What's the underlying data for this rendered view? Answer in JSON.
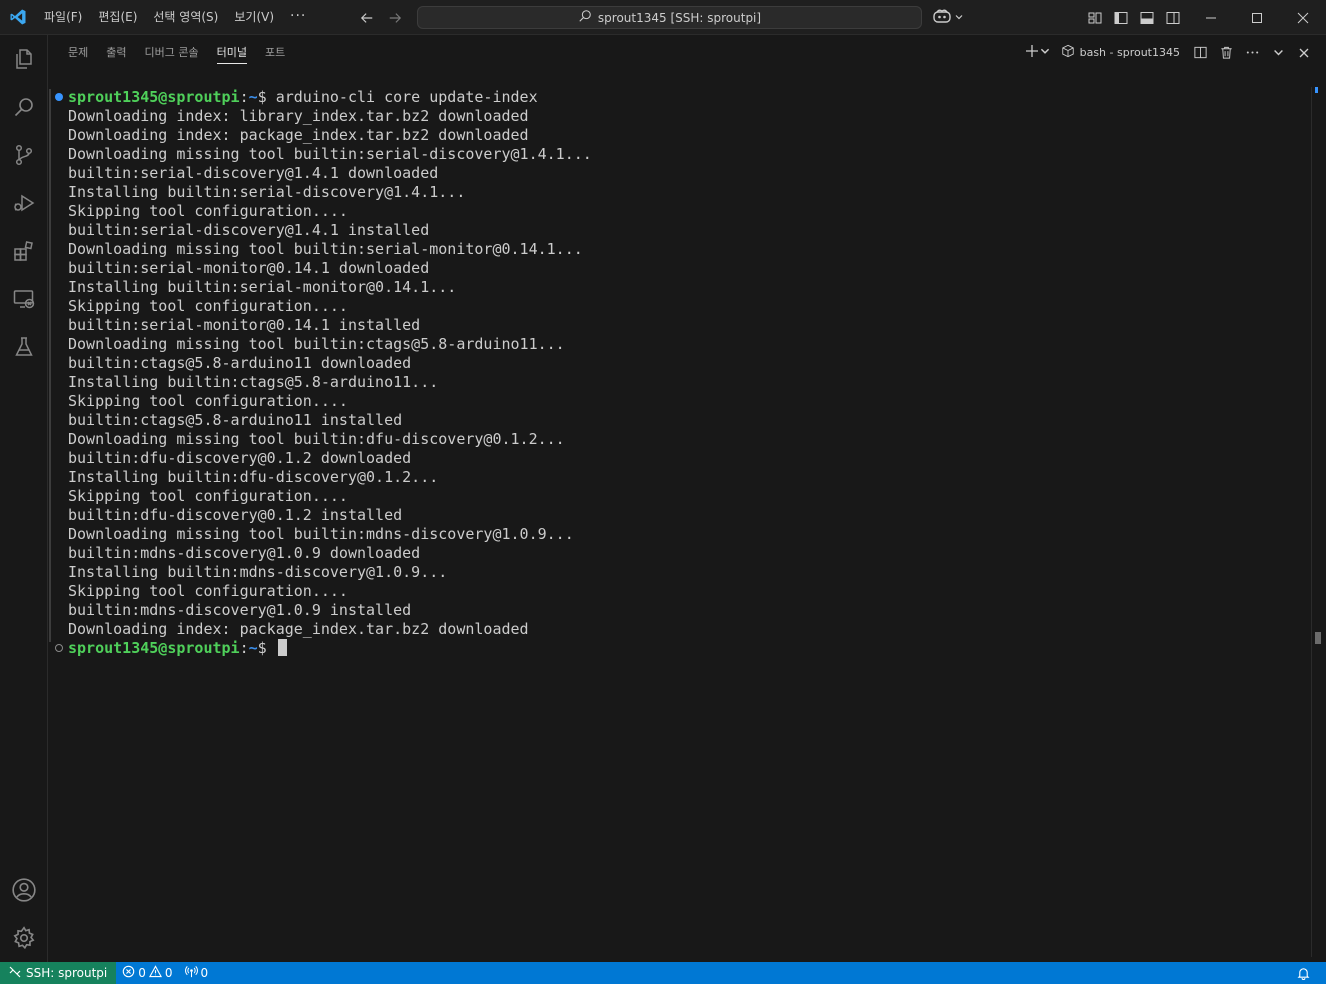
{
  "titlebar": {
    "menu": [
      {
        "label": "파일(F)"
      },
      {
        "label": "편집(E)"
      },
      {
        "label": "선택 영역(S)"
      },
      {
        "label": "보기(V)"
      }
    ],
    "more": "···",
    "command_center": "sprout1345 [SSH: sproutpi]"
  },
  "panel": {
    "tabs": [
      {
        "label": "문제"
      },
      {
        "label": "출력"
      },
      {
        "label": "디버그 콘솔"
      },
      {
        "label": "터미널"
      },
      {
        "label": "포트"
      }
    ],
    "active_tab": "터미널",
    "terminal_name": "bash - sprout1345"
  },
  "terminal": {
    "prompt_user": "sprout1345@sproutpi",
    "prompt_sep": ":",
    "prompt_path": "~",
    "prompt_symbol": "$",
    "command": "arduino-cli core update-index",
    "output": [
      "Downloading index: library_index.tar.bz2 downloaded",
      "Downloading index: package_index.tar.bz2 downloaded",
      "Downloading missing tool builtin:serial-discovery@1.4.1...",
      "builtin:serial-discovery@1.4.1 downloaded",
      "Installing builtin:serial-discovery@1.4.1...",
      "Skipping tool configuration....",
      "builtin:serial-discovery@1.4.1 installed",
      "Downloading missing tool builtin:serial-monitor@0.14.1...",
      "builtin:serial-monitor@0.14.1 downloaded",
      "Installing builtin:serial-monitor@0.14.1...",
      "Skipping tool configuration....",
      "builtin:serial-monitor@0.14.1 installed",
      "Downloading missing tool builtin:ctags@5.8-arduino11...",
      "builtin:ctags@5.8-arduino11 downloaded",
      "Installing builtin:ctags@5.8-arduino11...",
      "Skipping tool configuration....",
      "builtin:ctags@5.8-arduino11 installed",
      "Downloading missing tool builtin:dfu-discovery@0.1.2...",
      "builtin:dfu-discovery@0.1.2 downloaded",
      "Installing builtin:dfu-discovery@0.1.2...",
      "Skipping tool configuration....",
      "builtin:dfu-discovery@0.1.2 installed",
      "Downloading missing tool builtin:mdns-discovery@1.0.9...",
      "builtin:mdns-discovery@1.0.9 downloaded",
      "Installing builtin:mdns-discovery@1.0.9...",
      "Skipping tool configuration....",
      "builtin:mdns-discovery@1.0.9 installed",
      "Downloading index: package_index.tar.bz2 downloaded"
    ]
  },
  "statusbar": {
    "remote": "SSH: sproutpi",
    "errors": "0",
    "warnings": "0",
    "ports": "0"
  },
  "colors": {
    "accent": "#0078d4",
    "remote": "#16825d",
    "prompt_user": "#4fd05a",
    "prompt_path": "#3b8eea"
  }
}
